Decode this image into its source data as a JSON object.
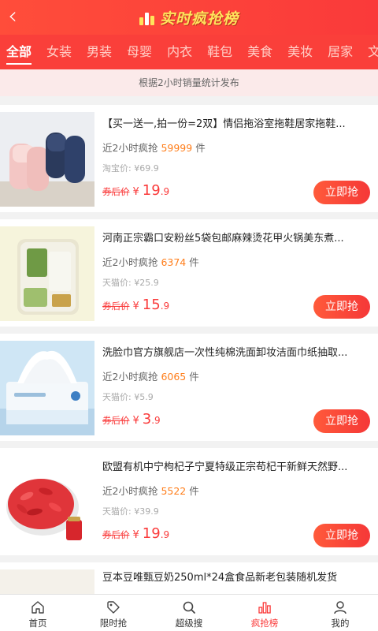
{
  "header": {
    "back_icon": "back-chevron-icon",
    "title": "实时疯抢榜",
    "logo_icon": "bar-chart-logo-icon"
  },
  "tabs": [
    "全部",
    "女装",
    "男装",
    "母婴",
    "内衣",
    "鞋包",
    "美食",
    "美妆",
    "居家",
    "文"
  ],
  "notice": "根据2小时销量统计发布",
  "products": [
    {
      "title": "【买一送一,拍一份=2双】情侣拖浴室拖鞋居家拖鞋...",
      "sales_label": "近2小时疯抢",
      "sales": "59999",
      "sales_unit": "件",
      "orig": "淘宝价: ¥69.9",
      "price_label": "券后价",
      "currency": "¥",
      "price_int": "19",
      "price_dec": ".9",
      "buy": "立即抢"
    },
    {
      "title": "河南正宗霸口安粉丝5袋包邮麻辣烫花甲火锅美东煮...",
      "sales_label": "近2小时疯抢",
      "sales": "6374",
      "sales_unit": "件",
      "orig": "天猫价: ¥25.9",
      "price_label": "券后价",
      "currency": "¥",
      "price_int": "15",
      "price_dec": ".9",
      "buy": "立即抢"
    },
    {
      "title": "洗脸巾官方旗舰店一次性纯棉洗面卸妆洁面巾纸抽取...",
      "sales_label": "近2小时疯抢",
      "sales": "6065",
      "sales_unit": "件",
      "orig": "天猫价: ¥5.9",
      "price_label": "券后价",
      "currency": "¥",
      "price_int": "3",
      "price_dec": ".9",
      "buy": "立即抢"
    },
    {
      "title": "欧盟有机中宁枸杞子宁夏特级正宗苟杞干新鲜天然野...",
      "sales_label": "近2小时疯抢",
      "sales": "5522",
      "sales_unit": "件",
      "orig": "天猫价: ¥39.9",
      "price_label": "券后价",
      "currency": "¥",
      "price_int": "19",
      "price_dec": ".9",
      "buy": "立即抢"
    }
  ],
  "partial_product": {
    "title": "豆本豆唯甄豆奶250ml*24盒食品新老包装随机发货"
  },
  "bottom_nav": [
    {
      "label": "首页",
      "icon": "home-icon"
    },
    {
      "label": "限时抢",
      "icon": "tag-icon"
    },
    {
      "label": "超级搜",
      "icon": "search-icon"
    },
    {
      "label": "疯抢榜",
      "icon": "ranking-icon"
    },
    {
      "label": "我的",
      "icon": "user-icon"
    }
  ],
  "colors": {
    "accent": "#fa3a3a",
    "sales_number": "#ff7e1b",
    "logo_text": "#ffe45c"
  }
}
